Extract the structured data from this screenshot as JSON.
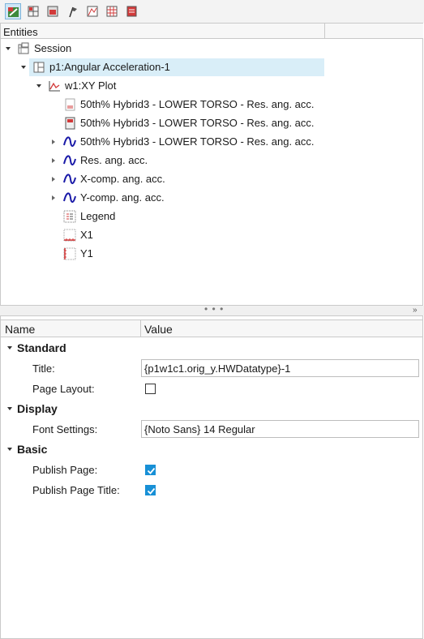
{
  "toolbar": {
    "buttons": [
      {
        "icon": "entities-tree-icon",
        "active": true
      },
      {
        "icon": "page-layout-icon",
        "active": false
      },
      {
        "icon": "window-icon",
        "active": false
      },
      {
        "icon": "flag-icon",
        "active": false
      },
      {
        "icon": "plot-axis-icon",
        "active": false
      },
      {
        "icon": "grid-panel-icon",
        "active": false
      },
      {
        "icon": "report-icon",
        "active": false
      }
    ]
  },
  "entities": {
    "header": "Entities",
    "tree": {
      "session": "Session",
      "page": "p1:Angular Acceleration-1",
      "window": "w1:XY Plot",
      "items": [
        {
          "label": "50th% Hybrid3   - LOWER TORSO - Res. ang. acc.",
          "icon": "note-icon",
          "expandable": false
        },
        {
          "label": "50th% Hybrid3   - LOWER TORSO - Res. ang. acc.",
          "icon": "datum-icon",
          "expandable": false
        },
        {
          "label": "50th% Hybrid3   - LOWER TORSO - Res. ang. acc.",
          "icon": "curve-icon",
          "expandable": true
        },
        {
          "label": "Res. ang. acc.",
          "icon": "curve-icon",
          "expandable": true
        },
        {
          "label": "X-comp. ang. acc.",
          "icon": "curve-icon",
          "expandable": true
        },
        {
          "label": "Y-comp. ang. acc.",
          "icon": "curve-icon",
          "expandable": true
        },
        {
          "label": "Legend",
          "icon": "legend-icon",
          "expandable": false
        },
        {
          "label": "X1",
          "icon": "x-axis-icon",
          "expandable": false
        },
        {
          "label": "Y1",
          "icon": "y-axis-icon",
          "expandable": false
        }
      ]
    }
  },
  "splitter": {
    "dots": "• • •",
    "collapse": "»"
  },
  "properties": {
    "col_name": "Name",
    "col_value": "Value",
    "groups": {
      "standard": "Standard",
      "display": "Display",
      "basic": "Basic"
    },
    "title_label": "Title:",
    "title_value": "{p1w1c1.orig_y.HWDatatype}-1",
    "page_layout_label": "Page Layout:",
    "page_layout_checked": false,
    "font_settings_label": "Font Settings:",
    "font_settings_value": "{Noto Sans} 14 Regular",
    "publish_page_label": "Publish Page:",
    "publish_page_checked": true,
    "publish_page_title_label": "Publish Page Title:",
    "publish_page_title_checked": true
  },
  "colors": {
    "accent": "#1890d6",
    "selection": "#d9eef8",
    "curve": "#1a1aa8"
  }
}
